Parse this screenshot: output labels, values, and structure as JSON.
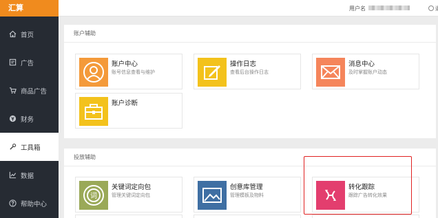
{
  "sidebar": {
    "brand": "汇算",
    "items": [
      {
        "label": "首页",
        "icon": "home-icon"
      },
      {
        "label": "广告",
        "icon": "ad-icon"
      },
      {
        "label": "商品广告",
        "icon": "cart-icon"
      },
      {
        "label": "财务",
        "icon": "money-icon"
      },
      {
        "label": "工具箱",
        "icon": "wrench-icon",
        "active": true
      },
      {
        "label": "数据",
        "icon": "chart-icon"
      },
      {
        "label": "帮助中心",
        "icon": "help-icon"
      }
    ]
  },
  "topbar": {
    "user_label": "用户名",
    "logout_label": "退出"
  },
  "account_section": {
    "title": "账户辅助",
    "cards": [
      {
        "title": "账户中心",
        "desc": "账号信息查看与维护",
        "icon": "user-icon",
        "color": "#f49a3a"
      },
      {
        "title": "操作日志",
        "desc": "查看后台操作日志",
        "icon": "edit-icon",
        "color": "#f3c21c"
      },
      {
        "title": "消息中心",
        "desc": "及时掌握账户动态",
        "icon": "mail-icon",
        "color": "#f5855b"
      },
      {
        "title": "账户诊断",
        "desc": "",
        "icon": "briefcase-icon",
        "color": "#f3c21c"
      }
    ]
  },
  "delivery_section": {
    "title": "投放辅助",
    "cards": [
      {
        "title": "关键词定向包",
        "desc": "管理关键词定向包",
        "icon": "keyword-icon",
        "color": "#9aa958"
      },
      {
        "title": "创意库管理",
        "desc": "管理模板及物料",
        "icon": "image-icon",
        "color": "#3f6fa3"
      },
      {
        "title": "转化跟踪",
        "desc": "跟踪广告转化效果",
        "icon": "convert-icon",
        "color": "#e33e6e"
      }
    ]
  }
}
